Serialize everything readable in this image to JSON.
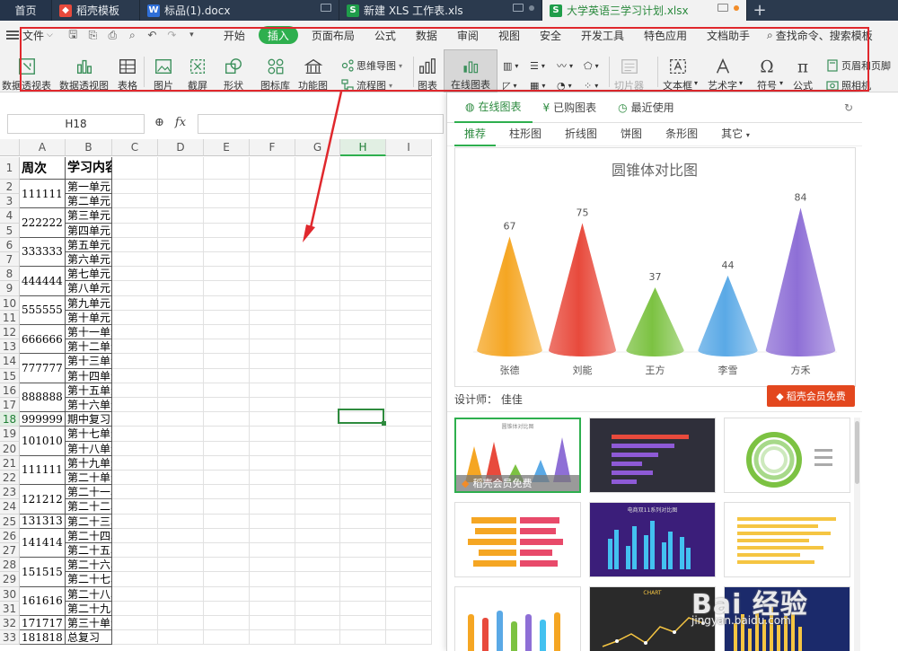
{
  "tabs": [
    {
      "label": "首页",
      "icon": "home"
    },
    {
      "label": "稻壳模板",
      "icon": "docer-icon"
    },
    {
      "label": "标品(1).docx",
      "icon": "word-icon"
    },
    {
      "label": "新建 XLS 工作表.xls",
      "icon": "sheet-icon"
    },
    {
      "label": "大学英语三学习计划.xlsx",
      "icon": "sheet-icon"
    }
  ],
  "menu": {
    "file": "文件",
    "items": [
      "开始",
      "插入",
      "页面布局",
      "公式",
      "数据",
      "审阅",
      "视图",
      "安全",
      "开发工具",
      "特色应用",
      "文档助手"
    ],
    "active": "插入",
    "search": "查找命令、搜索模板"
  },
  "ribbon": {
    "pivot_table": "数据透视表",
    "pivot_chart": "数据透视图",
    "table": "表格",
    "picture": "图片",
    "screenshot": "截屏",
    "shapes": "形状",
    "icon_lib": "图标库",
    "function_chart": "功能图",
    "mindmap": "思维导图",
    "flowchart": "流程图",
    "chart": "图表",
    "online_chart": "在线图表",
    "slice": "切片器",
    "textbox": "文本框",
    "wordart": "艺术字",
    "symbol": "符号",
    "formula": "公式",
    "header_footer": "页眉和页脚",
    "camera": "照相机"
  },
  "formula_bar": {
    "cell_ref": "H18",
    "fx": "fx",
    "value": ""
  },
  "grid": {
    "columns": [
      "A",
      "B",
      "C",
      "D",
      "E",
      "F",
      "G",
      "H",
      "I"
    ],
    "active_column": "H",
    "active_row": 18,
    "header_row": {
      "a": "周次",
      "b": "学习内容"
    },
    "col_a": [
      {
        "label": "111111",
        "span": 2
      },
      {
        "label": "222222",
        "span": 2
      },
      {
        "label": "333333",
        "span": 2
      },
      {
        "label": "444444",
        "span": 2
      },
      {
        "label": "555555",
        "span": 2
      },
      {
        "label": "666666",
        "span": 2
      },
      {
        "label": "777777",
        "span": 2
      },
      {
        "label": "888888",
        "span": 2
      },
      {
        "label": "999999",
        "span": 1
      },
      {
        "label": "101010",
        "span": 2
      },
      {
        "label": "111111",
        "span": 2
      },
      {
        "label": "121212",
        "span": 2
      },
      {
        "label": "131313",
        "span": 1
      },
      {
        "label": "141414",
        "span": 2
      },
      {
        "label": "151515",
        "span": 2
      },
      {
        "label": "161616",
        "span": 2
      },
      {
        "label": "171717",
        "span": 1
      },
      {
        "label": "181818",
        "span": 1
      }
    ],
    "col_b": [
      "第一单元",
      "第二单元",
      "第三单元",
      "第四单元",
      "第五单元",
      "第六单元",
      "第七单元",
      "第八单元",
      "第九单元",
      "第十单元",
      "第十一单元",
      "第十二单元",
      "第十三单元",
      "第十四单元",
      "第十五单元",
      "第十六单元",
      "期中复习",
      "第十七单元",
      "第十八单元",
      "第十九单元",
      "第二十单元",
      "第二十一单元",
      "第二十二单元",
      "第二十三单元",
      "第二十四单元",
      "第二十五单元",
      "第二十六单元",
      "第二十七单元",
      "第二十八单元",
      "第二十九单元",
      "第三十单元",
      "总复习"
    ]
  },
  "panel": {
    "tabs": [
      "在线图表",
      "已购图表",
      "最近使用"
    ],
    "active_tab": "在线图表",
    "categories": [
      "推荐",
      "柱形图",
      "折线图",
      "饼图",
      "条形图",
      "其它"
    ],
    "active_category": "推荐",
    "designer": "设计师：  佳佳",
    "member_btn": "稻壳会员免费",
    "thumb_badge": "稻壳会员免费",
    "thumb_titles": [
      "圆锥体对比图",
      "",
      "",
      "",
      "电商双11系列对比图",
      "",
      "",
      "CHART",
      ""
    ]
  },
  "chart_data": {
    "type": "bar",
    "title": "圆锥体对比图",
    "categories": [
      "张德",
      "刘能",
      "王方",
      "李雪",
      "方禾"
    ],
    "values": [
      67,
      75,
      37,
      44,
      84
    ],
    "colors": [
      "#f5a623",
      "#e84a3c",
      "#7cc242",
      "#5aa9e6",
      "#8e6fd6"
    ],
    "ylim": [
      0,
      90
    ],
    "grid": false,
    "legend": "none"
  },
  "watermark": {
    "text": "Bai 经验",
    "url": "jingyan.baidu.com"
  },
  "colors": {
    "accent": "#2eaf4e",
    "highlight": "#e0282d",
    "tabbar": "#2b3a4e"
  }
}
